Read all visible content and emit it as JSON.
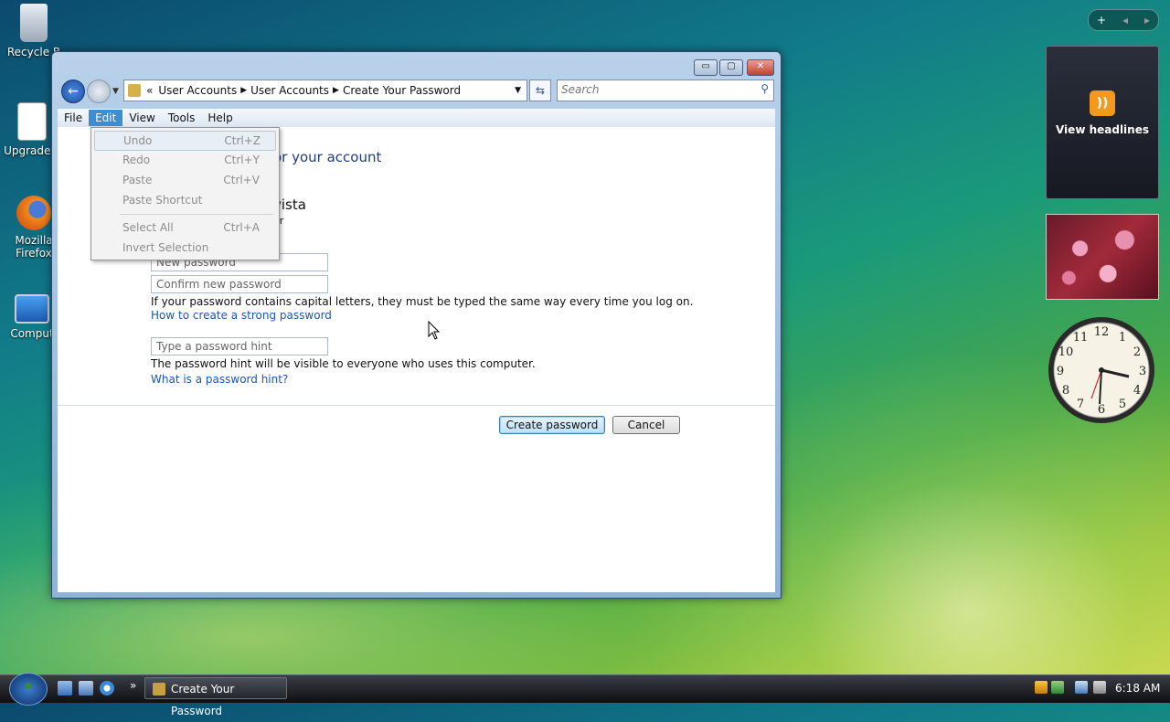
{
  "desktop": {
    "icons": [
      {
        "label": "Recycle B"
      },
      {
        "label": "Upgrade L"
      },
      {
        "label": "Mozilla Firefox"
      },
      {
        "label": "Comput"
      }
    ]
  },
  "sidebar": {
    "add_symbol": "+",
    "prev_symbol": "◂",
    "next_symbol": "▸",
    "feed_label": "View headlines"
  },
  "window": {
    "title": "Create Your Password",
    "controls": {
      "minimize": "▭",
      "maximize": "▢",
      "close": "✕"
    },
    "breadcrumb": [
      "User Accounts",
      "User Accounts",
      "Create Your Password"
    ],
    "search": {
      "placeholder": "Search"
    },
    "menu": [
      "File",
      "Edit",
      "View",
      "Tools",
      "Help"
    ],
    "active_menu": "Edit",
    "heading_partial": "or your account",
    "username_partial": "vista",
    "acct_type_partial": "or",
    "fields": {
      "new_password": "New password",
      "confirm_password": "Confirm new password",
      "hint": "Type a password hint"
    },
    "caps_note": "If your password contains capital letters, they must be typed the same way every time you log on.",
    "strong_link": "How to create a strong password",
    "hint_note": "The password hint will be visible to everyone who uses this computer.",
    "hint_link": "What is a password hint?",
    "buttons": {
      "create": "Create password",
      "cancel": "Cancel"
    }
  },
  "edit_menu": {
    "items": [
      {
        "label": "Undo",
        "shortcut": "Ctrl+Z"
      },
      {
        "label": "Redo",
        "shortcut": "Ctrl+Y"
      },
      {
        "label": "Paste",
        "shortcut": "Ctrl+V"
      },
      {
        "label": "Paste Shortcut",
        "shortcut": ""
      },
      {
        "label": "Select All",
        "shortcut": "Ctrl+A"
      },
      {
        "label": "Invert Selection",
        "shortcut": ""
      }
    ]
  },
  "taskbar": {
    "more_symbol": "»",
    "task_label": "Create Your Password",
    "time": "6:18 AM"
  },
  "colors": {
    "accent": "#3b8ed6",
    "link": "#1a58b0",
    "heading": "#1f3c80"
  }
}
